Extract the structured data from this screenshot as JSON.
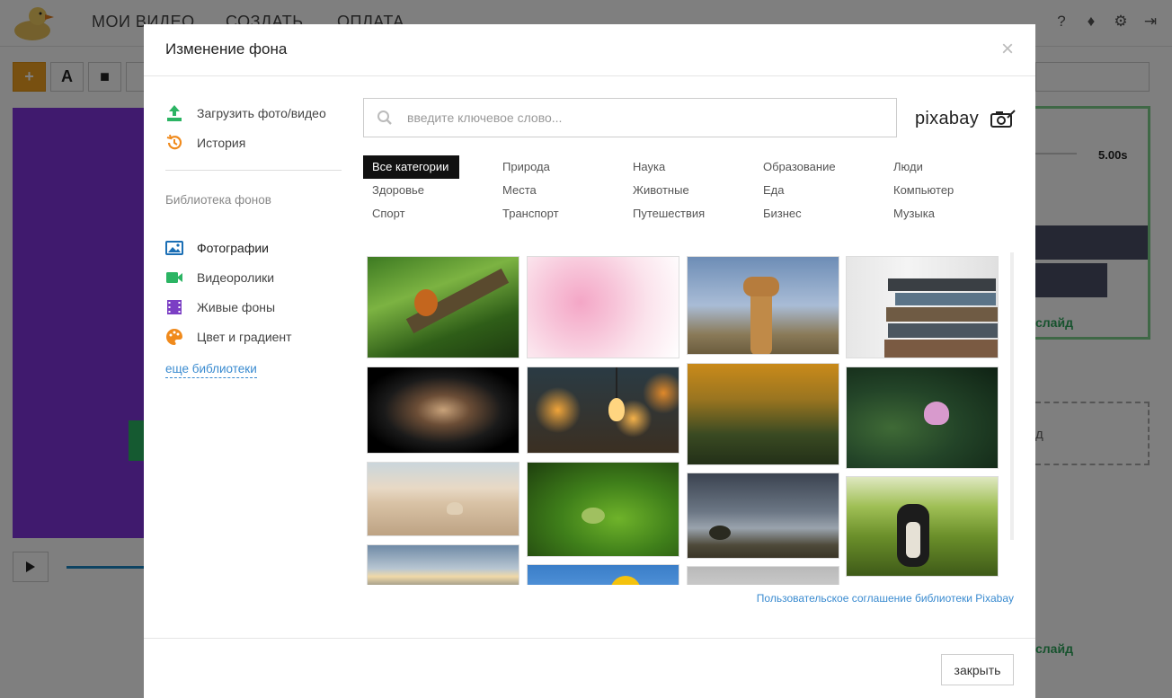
{
  "app": {
    "nav": [
      "МОИ ВИДЕО",
      "СОЗДАТЬ",
      "ОПЛАТА"
    ],
    "header_icons": [
      "help-icon",
      "bell-icon",
      "gear-icon",
      "logout-icon"
    ],
    "toolbar": [
      "+",
      "A",
      "■"
    ],
    "slide_duration": "5.00s",
    "slide_link": "слайд",
    "dashed_text": "д",
    "slide_link2": "слайд"
  },
  "modal": {
    "title": "Изменение фона",
    "close_glyph": "×",
    "upload_label": "Загрузить фото/видео",
    "history_label": "История",
    "library_title": "Библиотека фонов",
    "library_items": [
      {
        "label": "Фотографии",
        "icon": "image-icon",
        "color": "#1b6fb5"
      },
      {
        "label": "Видеоролики",
        "icon": "video-camera-icon",
        "color": "#2bb463"
      },
      {
        "label": "Живые фоны",
        "icon": "film-icon",
        "color": "#7b3fc4"
      },
      {
        "label": "Цвет и градиент",
        "icon": "palette-icon",
        "color": "#f08a1c"
      }
    ],
    "more_libraries": "еще библиотеки",
    "search_placeholder": "введите ключевое слово...",
    "brand": "pixabay",
    "categories": [
      "Все категории",
      "Природа",
      "Наука",
      "Образование",
      "Люди",
      "Здоровье",
      "Места",
      "Животные",
      "Еда",
      "Компьютер",
      "Спорт",
      "Транспорт",
      "Путешествия",
      "Бизнес",
      "Музыка"
    ],
    "active_category": "Все категории",
    "photos": [
      "squirrel on branch",
      "pink cherry blossoms",
      "giraffe",
      "stack of old books",
      "light bulb spiral",
      "hanging bulb bokeh",
      "golden field",
      "lotus flower",
      "beach shell",
      "frog on leaf",
      "storm clouds tree",
      "dog in grass",
      "sky clouds",
      "yellow flower",
      "pink wire"
    ],
    "terms_link": "Пользовательское соглашение библиотеки Pixabay",
    "close_button": "закрыть"
  }
}
